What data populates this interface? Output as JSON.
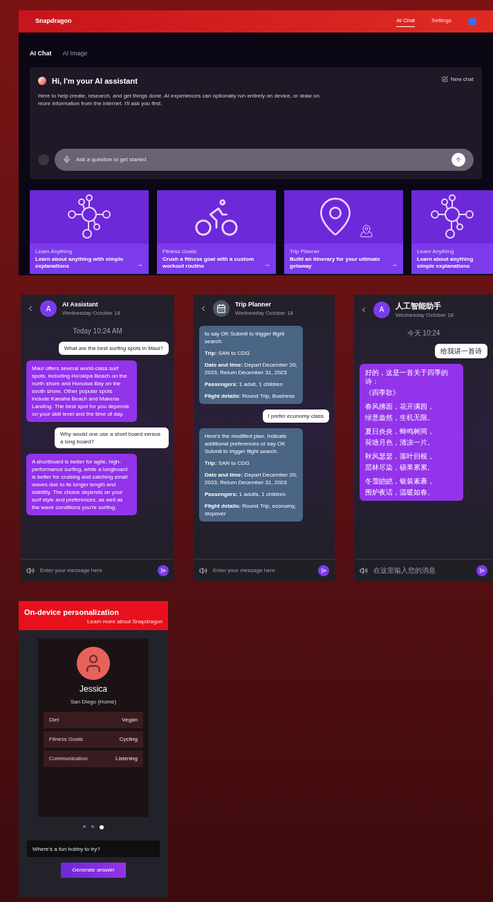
{
  "header": {
    "logo": "Snapdragon",
    "nav": [
      {
        "label": "AI Chat",
        "selected": true
      },
      {
        "label": "Settings",
        "selected": false
      }
    ]
  },
  "tabs": [
    {
      "label": "AI Chat",
      "selected": true
    },
    {
      "label": "AI Image",
      "selected": false
    }
  ],
  "hero": {
    "title": "Hi, I'm your AI assistant",
    "description": "Here to help create, research, and get things done. AI experiences can optionally run entirely on device, or draw on more information from the internet. I'll ask you first.",
    "corner_label": "New chat",
    "input": {
      "placeholder": "Ask a question to get started"
    }
  },
  "cards": [
    {
      "kind": "network",
      "caption": "Learn Anything",
      "title": "Learn about anything with simple explanations",
      "arrow": "→"
    },
    {
      "kind": "bike",
      "caption": "Fitness Goals",
      "title": "Crush a fitness goal with a custom workout routine",
      "arrow": "→"
    },
    {
      "kind": "pin",
      "caption": "Trip Planner",
      "title": "Build an itinerary for your ultimate getaway",
      "arrow": "→"
    },
    {
      "kind": "network",
      "caption": "Learn Anything",
      "title": "Learn about anything simple explanations"
    }
  ],
  "chats": [
    {
      "avatar": "A",
      "name": "AI Assistant",
      "date": "Wednesday October 18",
      "placeholder": "Enter your message here",
      "messages": [
        {
          "kind": "note",
          "text": "Today 10:24 AM"
        },
        {
          "kind": "user",
          "text": "What are the best surfing spots in Maui?"
        },
        {
          "kind": "bot",
          "text": "Maui offers several world-class surf spots, including Ho'okipa Beach on the north shore and Honolua Bay on the south shore. Other popular spots include Kanaha Beach and Makena Landing. The best spot for you depends on your skill level and the time of day."
        },
        {
          "kind": "user",
          "text": "Why would one use a short board versus a long board?"
        },
        {
          "kind": "bot",
          "text": "A shortboard is better for agile, high-performance surfing, while a longboard is better for cruising and catching small waves due to its longer length and stability. The choice depends on your surf style and preferences, as well as the wave conditions you're surfing."
        }
      ]
    },
    {
      "name": "Trip Planner",
      "date": "Wednesday October 18",
      "placeholder": "Enter your message here",
      "messages": [
        {
          "kind": "card",
          "lines": [
            "to say OK Submit to trigger flight search.",
            "**Trip:** SAN to CDG",
            "**Date and time:** Depart December 20, 2023, Return December 31, 2023",
            "**Passengers:** 1 adult, 1 children",
            "**Flight details:** Round Trip, Business"
          ]
        },
        {
          "kind": "user",
          "text": "I prefer economy class"
        },
        {
          "kind": "card",
          "lines": [
            "Here's the modified plan. Indicate additional preferences or say OK Submit to trigger flight search.",
            "**Trip:** SAN to CDG",
            "**Date and time:** Depart December 20, 2023, Return December 31, 2023",
            "**Passengers:** 1 adults, 1 children",
            "**Flight details:** Round Trip, economy, stopover"
          ]
        }
      ]
    },
    {
      "avatar": "A",
      "name": "人工智能助手",
      "date": "Wednesday October 18",
      "placeholder": "在这里输入您的消息",
      "messages": [
        {
          "kind": "note",
          "text": "今天 10:24"
        },
        {
          "kind": "user",
          "text": "给我讲一首诗"
        },
        {
          "kind": "poem",
          "lines": [
            "好的，这是一首关于四季的诗：",
            "《四季歌》",
            "春风拂面，花开满园，",
            "绿意盎然，生机无限。",
            "夏日炎炎，蝉鸣树间，",
            "荷塘月色，清凉一片。",
            "秋风瑟瑟，落叶归根，",
            "层林尽染，硕果累累。",
            "冬雪皑皑，银装素裹，",
            "围炉夜话，温暖如春。"
          ]
        }
      ]
    }
  ],
  "personalization": {
    "title": "On-device personalization",
    "subtitle": "Learn more about Snapdragon",
    "profile": {
      "name": "Jessica",
      "location": "San Diego (Home)",
      "rows": [
        {
          "label": "Diet",
          "value": "Vegan"
        },
        {
          "label": "Fitness Goals",
          "value": "Cycling"
        },
        {
          "label": "Communication",
          "value": "Listening"
        }
      ]
    },
    "pages": [
      {
        "selected": false
      },
      {
        "selected": false
      },
      {
        "selected": true
      }
    ],
    "input": {
      "value": "Where's a fun hobby to try?"
    },
    "button": "Generate answer"
  }
}
